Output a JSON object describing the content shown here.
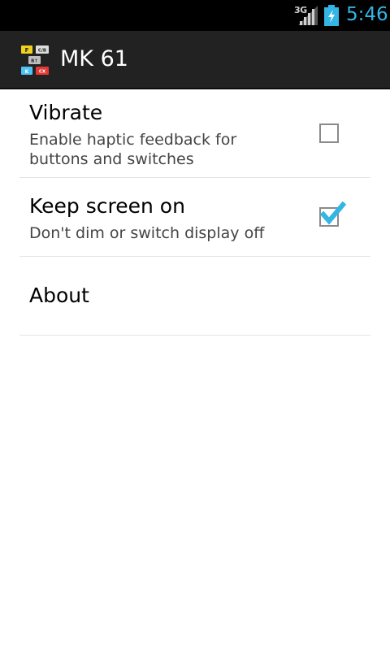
{
  "status_bar": {
    "network": "3G",
    "time": "5:46",
    "time_color": "#33b5e5",
    "icons": [
      "signal-icon",
      "battery-charging-icon"
    ]
  },
  "action_bar": {
    "title": "MK 61",
    "icon": "calculator-app-icon",
    "background": "#222222"
  },
  "preferences": [
    {
      "title": "Vibrate",
      "summary": "Enable haptic feedback for buttons and switches",
      "checked": false
    },
    {
      "title": "Keep screen on",
      "summary": "Don't dim or switch display off",
      "checked": true
    },
    {
      "title": "About"
    }
  ],
  "accent_color": "#33b5e5"
}
